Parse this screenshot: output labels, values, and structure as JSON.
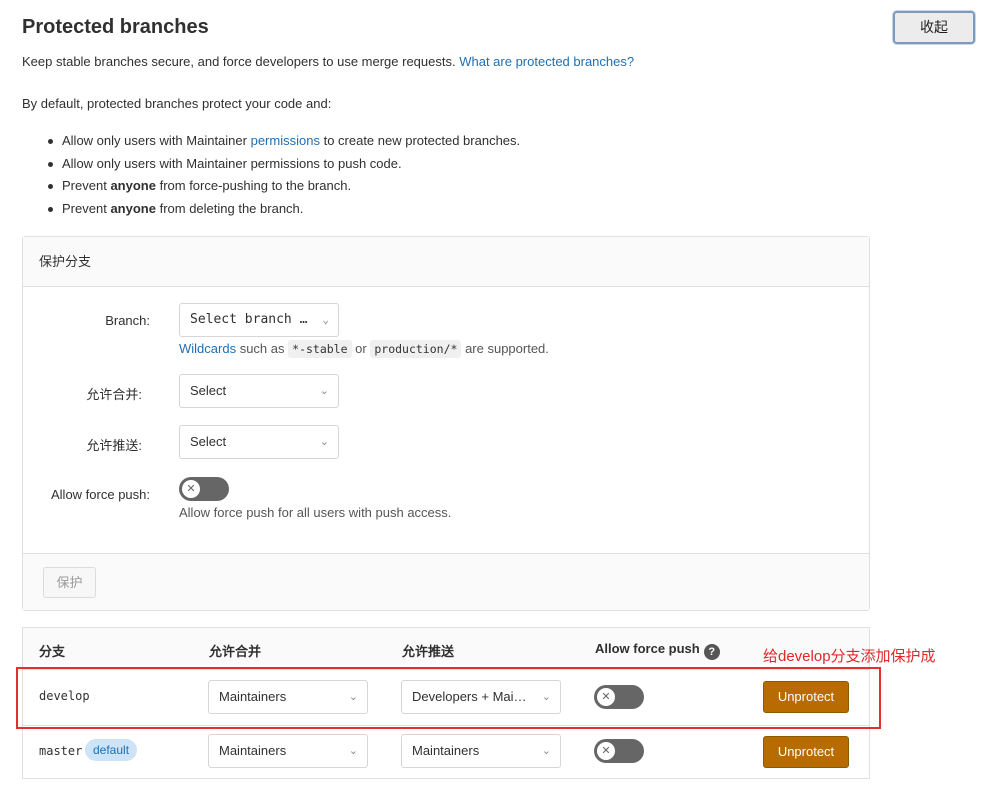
{
  "header": {
    "title": "Protected branches",
    "collapse_label": "收起"
  },
  "intro": {
    "text": "Keep stable branches secure, and force developers to use merge requests.",
    "link": "What are protected branches?"
  },
  "defaults": {
    "lead": "By default, protected branches protect your code and:",
    "rule1_pre": "Allow only users with Maintainer",
    "rule1_link": "permissions",
    "rule1_post": "to create new protected branches.",
    "rule2": "Allow only users with Maintainer permissions to push code.",
    "rule3_pre": "Prevent",
    "rule3_bold": "anyone",
    "rule3_post": "from force-pushing to the branch.",
    "rule4_pre": "Prevent",
    "rule4_bold": "anyone",
    "rule4_post": "from deleting the branch."
  },
  "form": {
    "card_title": "保护分支",
    "branch_label": "Branch:",
    "branch_select": "Select branch …",
    "wildcards_link": "Wildcards",
    "wildcards_such_as": "such as",
    "wildcard_example1": "*-stable",
    "wildcard_or": "or",
    "wildcard_example2": "production/*",
    "wildcard_supported": "are supported.",
    "merge_label": "允许合并:",
    "merge_select": "Select",
    "push_label": "允许推送:",
    "push_select": "Select",
    "force_push_label": "Allow force push:",
    "force_push_hint": "Allow force push for all users with push access.",
    "protect_button": "保护"
  },
  "table": {
    "columns": [
      "分支",
      "允许合并",
      "允许推送",
      "Allow force push"
    ],
    "rows": [
      {
        "branch": "develop",
        "badge": "",
        "merge": "Maintainers",
        "push": "Developers + Mai…",
        "force_push": false,
        "action": "Unprotect"
      },
      {
        "branch": "master",
        "badge": "default",
        "merge": "Maintainers",
        "push": "Maintainers",
        "force_push": false,
        "action": "Unprotect"
      }
    ]
  },
  "annotation": {
    "text": "给develop分支添加保护成",
    "color": "#e02828"
  },
  "colors": {
    "link": "#1f6fb3",
    "unprotect": "#b76b00",
    "toggle_off": "#666666"
  }
}
